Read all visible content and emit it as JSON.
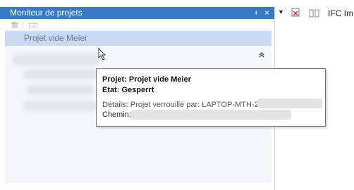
{
  "panel": {
    "title": "Moniteur de projets",
    "pin_glyph": "ᵻ",
    "close_glyph": "×",
    "selected_project_label": "Projet vide Meier",
    "collapse_glyph": "«"
  },
  "right_toolbar": {
    "dropdown_glyph": "▼",
    "ifc_label": "IFC Im"
  },
  "tooltip": {
    "project_line": "Projet: Projet vide Meier",
    "state_line": "Etat: Gesperrt",
    "details_line": "Détails: Projet verrouillé par: LAPTOP-MTH-2C",
    "path_label": "Chemin:"
  },
  "colors": {
    "titlebar": "#3778c9",
    "selected_row": "#c9d9f1",
    "panel_bg": "#f4f6fb"
  }
}
